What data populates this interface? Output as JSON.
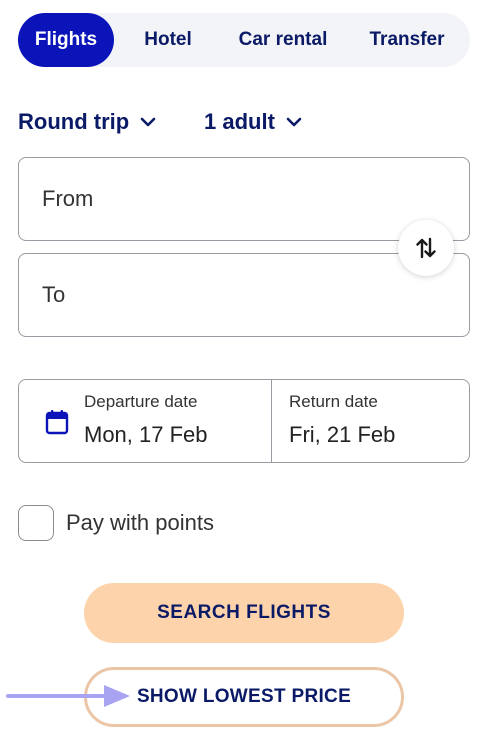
{
  "tabs": [
    {
      "label": "Flights",
      "active": true
    },
    {
      "label": "Hotel",
      "active": false
    },
    {
      "label": "Car rental",
      "active": false
    },
    {
      "label": "Transfer",
      "active": false
    }
  ],
  "trip_options": {
    "trip_type": "Round trip",
    "passengers": "1 adult"
  },
  "from_field": {
    "placeholder": "From"
  },
  "to_field": {
    "placeholder": "To"
  },
  "dates": {
    "departure_label": "Departure date",
    "departure_value": "Mon, 17 Feb",
    "return_label": "Return date",
    "return_value": "Fri, 21 Feb"
  },
  "pay_with_points": {
    "label": "Pay with points",
    "checked": false
  },
  "buttons": {
    "search": "SEARCH FLIGHTS",
    "lowest_price": "SHOW LOWEST PRICE"
  },
  "colors": {
    "brand_blue": "#0a14b8",
    "text_navy": "#0a1a66",
    "search_button": "#fdd3ab",
    "lowest_border": "#ebc6a6",
    "arrow": "#a9a4f2"
  },
  "icons": [
    "chevron-down-icon",
    "swap-vertical-icon",
    "calendar-icon",
    "arrow-right-icon"
  ]
}
